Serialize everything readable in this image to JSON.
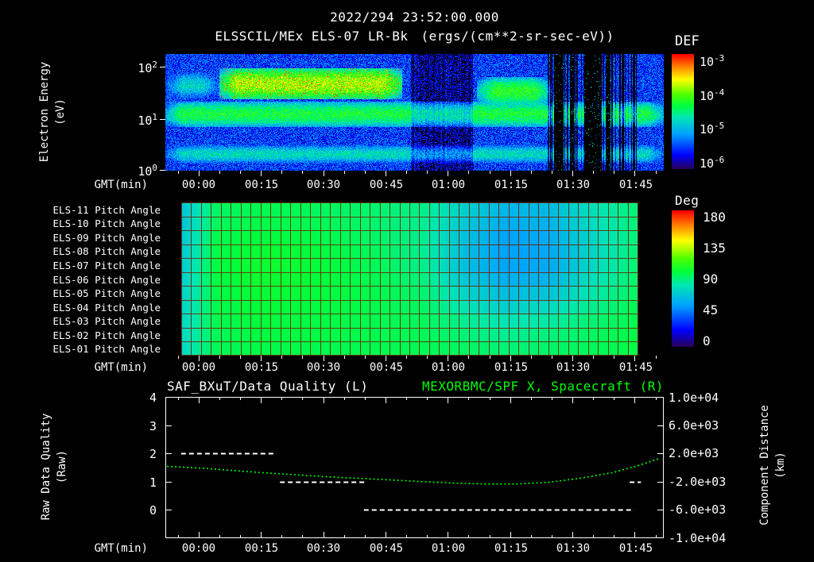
{
  "header": {
    "timestamp": "2022/294 23:52:00.000",
    "instrument_title": "ELSSCIL/MEx ELS-07 LR-Bk",
    "units": "(ergs/(cm**2-sr-sec-eV))"
  },
  "xaxis": {
    "label": "GMT(min)",
    "ticks": [
      "00:00",
      "00:15",
      "00:30",
      "00:45",
      "01:00",
      "01:15",
      "01:30",
      "01:45"
    ]
  },
  "spectrogram_panel": {
    "ylabel_line1": "Electron Energy",
    "ylabel_line2": "(eV)",
    "yticks": [
      {
        "base": "10",
        "exp": "2"
      },
      {
        "base": "10",
        "exp": "1"
      },
      {
        "base": "10",
        "exp": "0"
      }
    ],
    "colorbar_title": "DEF",
    "colorbar_ticks": [
      {
        "base": "10",
        "exp": "-3"
      },
      {
        "base": "10",
        "exp": "-4"
      },
      {
        "base": "10",
        "exp": "-5"
      },
      {
        "base": "10",
        "exp": "-6"
      }
    ]
  },
  "pitch_panel": {
    "row_labels": [
      "ELS-11 Pitch Angle",
      "ELS-10 Pitch Angle",
      "ELS-09 Pitch Angle",
      "ELS-08 Pitch Angle",
      "ELS-07 Pitch Angle",
      "ELS-06 Pitch Angle",
      "ELS-05 Pitch Angle",
      "ELS-04 Pitch Angle",
      "ELS-03 Pitch Angle",
      "ELS-02 Pitch Angle",
      "ELS-01 Pitch Angle"
    ],
    "colorbar_title": "Deg",
    "colorbar_ticks": [
      "180",
      "135",
      "90",
      "45",
      "0"
    ]
  },
  "line_panel": {
    "title_left": "SAF_BXuT/Data Quality (L)",
    "title_right": "MEXORBMC/SPF X, Spacecraft (R)",
    "ylabel_left_line1": "Raw Data Quality",
    "ylabel_left_line2": "(Raw)",
    "ylabel_right_line1": "Component Distance",
    "ylabel_right_line2": "(km)",
    "yticks_left": [
      "4",
      "3",
      "2",
      "1",
      "0"
    ],
    "yticks_right": [
      "1.0e+04",
      "6.0e+03",
      "2.0e+03",
      "-2.0e+03",
      "-6.0e+03",
      "-1.0e+04"
    ]
  },
  "colors": {
    "background": "#000000",
    "text": "#ffffff",
    "green_series": "#00ff00",
    "grid_red": "#6e1e00"
  },
  "chart_data": [
    {
      "type": "heatmap",
      "name": "electron-energy-spectrogram",
      "title": "ELSSCIL/MEx ELS-07 LR-Bk",
      "value_label": "DEF (ergs/(cm**2-sr-sec-eV))",
      "time_start": "2022/294 23:52:00.000",
      "t_range_min": [
        0,
        120
      ],
      "x_tick_minutes": [
        8,
        23,
        38,
        53,
        68,
        83,
        98,
        113
      ],
      "x_tick_labels": [
        "00:00",
        "00:15",
        "00:30",
        "00:45",
        "01:00",
        "01:15",
        "01:30",
        "01:45"
      ],
      "y_scale": "log",
      "y_range_ev": [
        1,
        178
      ],
      "y_tick_ev": [
        100,
        10,
        1
      ],
      "value_scale": "log",
      "value_range": [
        1e-06,
        0.001
      ],
      "features": {
        "background_log_level": -5.7,
        "bands": [
          {
            "name": "low-energy speckle band",
            "ev": [
              1.4,
              3.2
            ],
            "t": [
              0,
              120
            ],
            "log_level": -4.9
          },
          {
            "name": "persistent 10-20 eV band",
            "ev": [
              7,
              22
            ],
            "t": [
              0,
              120
            ],
            "log_level": -4.45
          },
          {
            "name": "weak pre-enhancement",
            "ev": [
              25,
              80
            ],
            "t": [
              0,
              13
            ],
            "log_level": -4.95
          },
          {
            "name": "main enhancement 25-95 eV",
            "ev": [
              24,
              95
            ],
            "t": [
              13,
              57
            ],
            "log_level": -3.95,
            "speckle_log_level": -3.35
          },
          {
            "name": "secondary enhancement 01:15-01:25",
            "ev": [
              18,
              65
            ],
            "t": [
              75,
              93
            ],
            "log_level": -4.35
          }
        ],
        "dim_region_t": [
          59,
          74
        ],
        "dark_columns_t": [
          [
            93.5,
            96
          ],
          [
            97.3,
            98.6
          ],
          [
            100.8,
            104.8
          ],
          [
            106,
            107
          ]
        ],
        "streaky_region_t": [
          92,
          114
        ]
      }
    },
    {
      "type": "heatmap",
      "name": "pitch-angle-panels",
      "rows": [
        "ELS-11",
        "ELS-10",
        "ELS-09",
        "ELS-08",
        "ELS-07",
        "ELS-06",
        "ELS-05",
        "ELS-04",
        "ELS-03",
        "ELS-02",
        "ELS-01"
      ],
      "units": "deg",
      "value_range": [
        0,
        180
      ],
      "data_t_range": [
        3.8,
        113.5
      ],
      "t_bins_min": [
        4,
        12,
        22,
        32,
        42,
        52,
        62,
        72,
        82,
        92,
        102,
        113
      ],
      "values_deg": [
        [
          68,
          93,
          96,
          95,
          93,
          91,
          87,
          72,
          62,
          64,
          78,
          90
        ],
        [
          68,
          94,
          97,
          96,
          94,
          91,
          86,
          69,
          59,
          61,
          76,
          90
        ],
        [
          69,
          96,
          99,
          98,
          95,
          92,
          86,
          66,
          56,
          58,
          74,
          90
        ],
        [
          70,
          97,
          101,
          100,
          97,
          93,
          86,
          65,
          55,
          57,
          74,
          90
        ],
        [
          71,
          98,
          102,
          101,
          98,
          94,
          87,
          66,
          56,
          58,
          75,
          91
        ],
        [
          72,
          98,
          102,
          101,
          98,
          95,
          89,
          69,
          60,
          62,
          78,
          92
        ],
        [
          73,
          97,
          101,
          100,
          98,
          96,
          91,
          74,
          65,
          68,
          81,
          93
        ],
        [
          74,
          96,
          100,
          99,
          98,
          96,
          93,
          80,
          72,
          76,
          86,
          95
        ],
        [
          75,
          96,
          99,
          98,
          97,
          96,
          94,
          86,
          80,
          83,
          90,
          96
        ],
        [
          76,
          95,
          98,
          98,
          97,
          96,
          95,
          90,
          86,
          89,
          93,
          97
        ],
        [
          76,
          95,
          97,
          97,
          96,
          96,
          95,
          93,
          90,
          92,
          94,
          97
        ]
      ]
    },
    {
      "type": "line",
      "name": "quality-and-spacecraft-distance",
      "t_range_min": [
        0,
        120
      ],
      "series": [
        {
          "name": "SAF_BXuT/Data Quality (L)",
          "axis": "left",
          "color": "#ffffff",
          "line_style": "dashed",
          "segments": [
            {
              "t": [
                3.8,
                26.8
              ],
              "value": 2
            },
            {
              "t": [
                27.6,
                48.2
              ],
              "value": 1
            },
            {
              "t": [
                47.8,
                112.9
              ],
              "value": 0
            },
            {
              "t": [
                111.8,
                114.5
              ],
              "value": 1
            }
          ]
        },
        {
          "name": "MEXORBMC/SPF X, Spacecraft (R)",
          "axis": "right",
          "color": "#00ff00",
          "line_style": "dotted",
          "points_t_km": [
            [
              0.4,
              170
            ],
            [
              8,
              -60
            ],
            [
              23.4,
              -730
            ],
            [
              38.7,
              -1300
            ],
            [
              54,
              -1750
            ],
            [
              61.6,
              -1980
            ],
            [
              69.3,
              -2200
            ],
            [
              77,
              -2320
            ],
            [
              84.6,
              -2320
            ],
            [
              92.3,
              -2090
            ],
            [
              99.9,
              -1520
            ],
            [
              107.6,
              -730
            ],
            [
              113.3,
              170
            ],
            [
              119,
              1300
            ]
          ]
        }
      ],
      "left_axis": {
        "label": "Raw Data Quality (Raw)",
        "range": [
          -1,
          4
        ],
        "ticks": [
          4,
          3,
          2,
          1,
          0
        ]
      },
      "right_axis": {
        "label": "Component Distance (km)",
        "range": [
          -10000,
          10000
        ],
        "ticks": [
          10000,
          6000,
          2000,
          -2000,
          -6000,
          -10000
        ]
      }
    }
  ]
}
